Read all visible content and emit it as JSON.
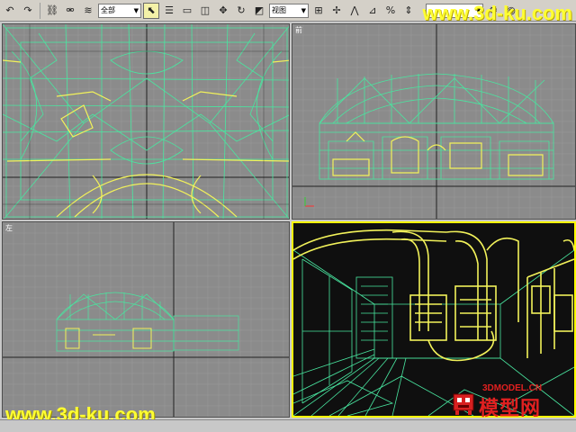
{
  "toolbar": {
    "tools": [
      {
        "name": "undo-icon",
        "glyph": "↶"
      },
      {
        "name": "redo-icon",
        "glyph": "↷"
      },
      {
        "name": "select-and-link-icon",
        "glyph": "⛓"
      },
      {
        "name": "unlink-icon",
        "glyph": "⚮"
      },
      {
        "name": "bind-space-warp-icon",
        "glyph": "≋"
      }
    ],
    "selection_filter": "全部",
    "select_tools": [
      {
        "name": "select-object-icon",
        "glyph": "⬉",
        "active": true
      },
      {
        "name": "select-by-name-icon",
        "glyph": "☰",
        "active": false
      },
      {
        "name": "rectangular-selection-icon",
        "glyph": "▭",
        "active": false
      },
      {
        "name": "window-crossing-icon",
        "glyph": "◫",
        "active": false
      },
      {
        "name": "move-icon",
        "glyph": "✥",
        "active": false
      },
      {
        "name": "rotate-icon",
        "glyph": "↻",
        "active": false
      },
      {
        "name": "scale-icon",
        "glyph": "◩",
        "active": false
      }
    ],
    "reference_coordinate": "视图",
    "manip_tools": [
      {
        "name": "use-pivot-center-icon",
        "glyph": "⊞"
      },
      {
        "name": "select-manipulate-icon",
        "glyph": "✢"
      },
      {
        "name": "snaps-toggle-icon",
        "glyph": "⋀"
      },
      {
        "name": "angle-snap-icon",
        "glyph": "⊿"
      },
      {
        "name": "percent-snap-icon",
        "glyph": "%"
      },
      {
        "name": "spinner-snap-icon",
        "glyph": "⇕"
      }
    ],
    "named_selection": "",
    "right_tools": [
      {
        "name": "render-scene-icon",
        "glyph": "⚙"
      },
      {
        "name": "quick-render-icon",
        "glyph": "◉"
      }
    ],
    "brand_text": "www.3d-ku.com"
  },
  "viewports": {
    "top_label": "",
    "front_label": "前",
    "left_label": "左",
    "perspective_label": ""
  },
  "watermarks": {
    "bottom_left": "www.3d-ku.com",
    "logo_en": "3DMODEL.CN",
    "logo_cn": "模型网"
  },
  "colors": {
    "viewport_bg": "#8b8b8b",
    "perspective_bg": "#0f0f0f",
    "wire_green": "#49e6a0",
    "wire_yellow": "#f2f25a",
    "active_border": "#ffff00",
    "brand": "#ffff33",
    "logo_red": "#e02020"
  }
}
